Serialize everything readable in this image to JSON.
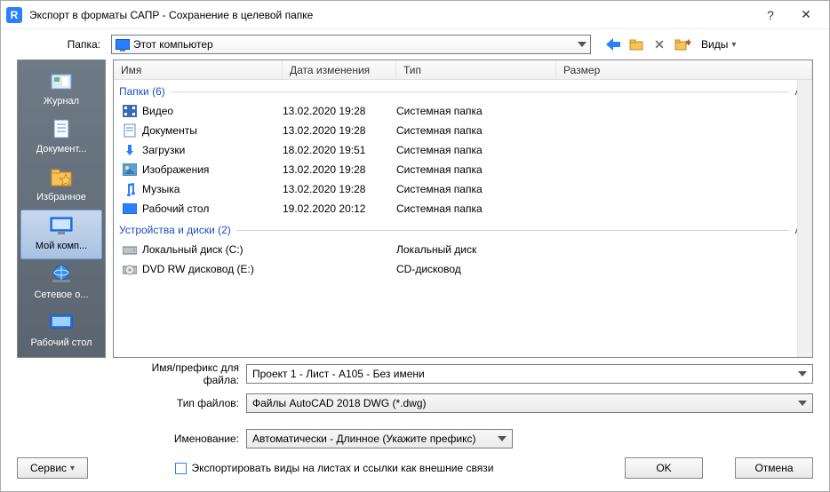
{
  "title": "Экспорт в форматы САПР - Сохранение в целевой папке",
  "toolbar": {
    "folder_label": "Папка:",
    "folder_value": "Этот компьютер",
    "views_label": "Виды"
  },
  "places": [
    {
      "label": "Журнал"
    },
    {
      "label": "Документ..."
    },
    {
      "label": "Избранное"
    },
    {
      "label": "Мой комп..."
    },
    {
      "label": "Сетевое о..."
    },
    {
      "label": "Рабочий стол"
    }
  ],
  "columns": {
    "name": "Имя",
    "date": "Дата изменения",
    "type": "Тип",
    "size": "Размер"
  },
  "groups": {
    "folders": "Папки (6)",
    "drives": "Устройства и диски (2)"
  },
  "rows": [
    {
      "name": "Видео",
      "date": "13.02.2020 19:28",
      "type": "Системная папка",
      "icon": "video"
    },
    {
      "name": "Документы",
      "date": "13.02.2020 19:28",
      "type": "Системная папка",
      "icon": "doc"
    },
    {
      "name": "Загрузки",
      "date": "18.02.2020 19:51",
      "type": "Системная папка",
      "icon": "down"
    },
    {
      "name": "Изображения",
      "date": "13.02.2020 19:28",
      "type": "Системная папка",
      "icon": "pic"
    },
    {
      "name": "Музыка",
      "date": "13.02.2020 19:28",
      "type": "Системная папка",
      "icon": "music"
    },
    {
      "name": "Рабочий стол",
      "date": "19.02.2020 20:12",
      "type": "Системная папка",
      "icon": "desk"
    }
  ],
  "drives": [
    {
      "name": "Локальный диск (C:)",
      "date": "",
      "type": "Локальный диск",
      "icon": "hdd"
    },
    {
      "name": "DVD RW дисковод (E:)",
      "date": "",
      "type": "CD-дисковод",
      "icon": "dvd"
    }
  ],
  "form": {
    "filename_label": "Имя/префикс для файла:",
    "filename_value": "Проект 1 - Лист - A105 - Без имени",
    "filetype_label": "Тип файлов:",
    "filetype_value": "Файлы AutoCAD 2018 DWG  (*.dwg)",
    "naming_label": "Именование:",
    "naming_value": "Автоматически - Длинное (Укажите префикс)"
  },
  "bottom": {
    "service": "Сервис",
    "checkbox": "Экспортировать виды на листах и ссылки как внешние связи",
    "ok": "OK",
    "cancel": "Отмена"
  }
}
